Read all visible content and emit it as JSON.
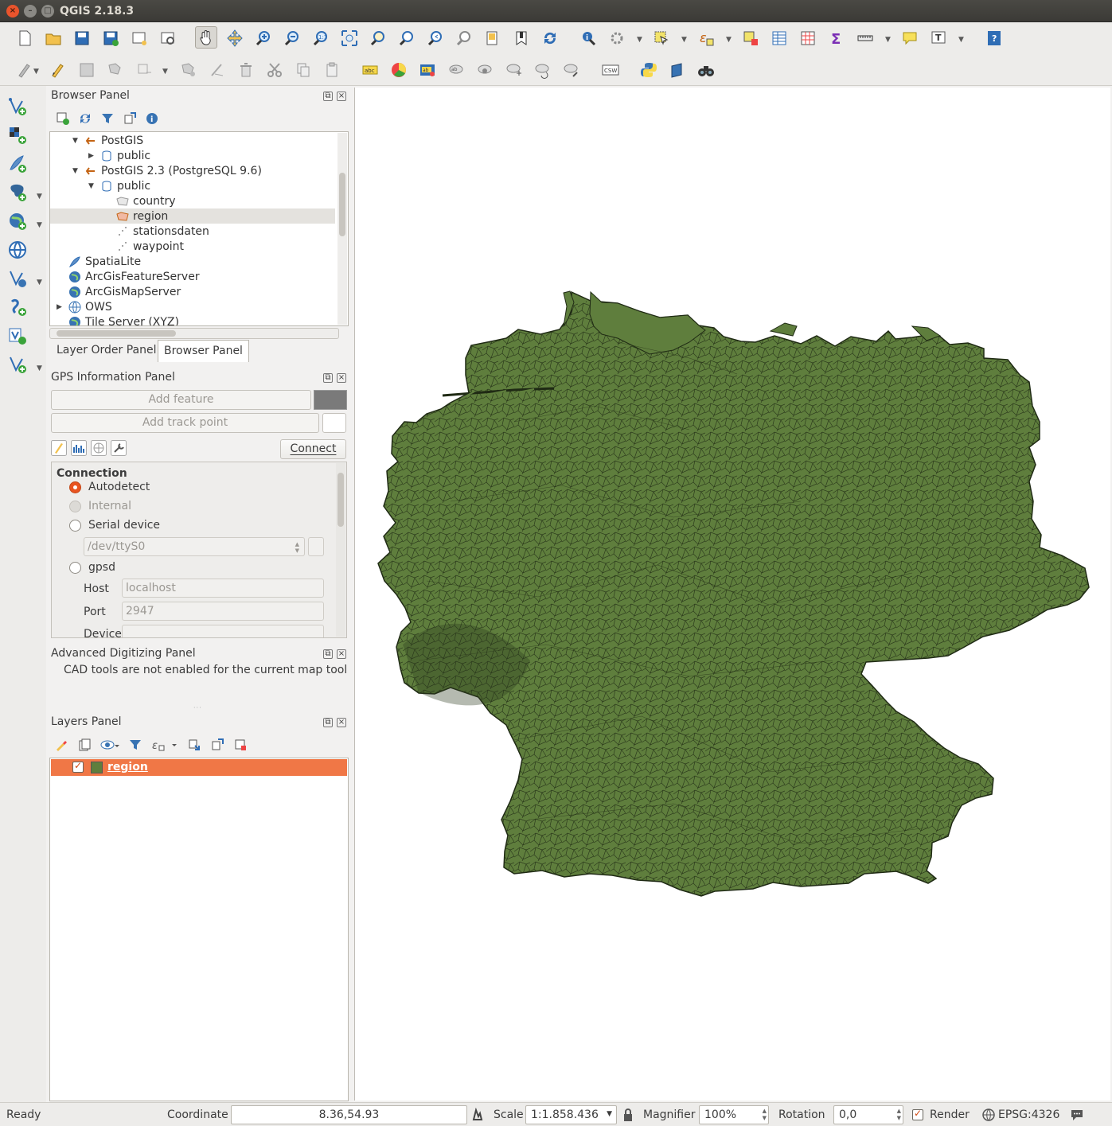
{
  "window": {
    "title": "QGIS 2.18.3"
  },
  "browser_panel": {
    "title": "Browser Panel",
    "tree": [
      {
        "label": "PostGIS",
        "level": 1,
        "arrow": "▼",
        "icon": "postgis-connection-icon"
      },
      {
        "label": "public",
        "level": 2,
        "arrow": "▶",
        "icon": "schema-icon"
      },
      {
        "label": "PostGIS 2.3 (PostgreSQL 9.6)",
        "level": 1,
        "arrow": "▼",
        "icon": "postgis-connection-icon"
      },
      {
        "label": "public",
        "level": 2,
        "arrow": "▼",
        "icon": "schema-icon"
      },
      {
        "label": "country",
        "level": 3,
        "arrow": "",
        "icon": "polygon-layer-icon"
      },
      {
        "label": "region",
        "level": 3,
        "arrow": "",
        "icon": "polygon-layer-icon",
        "selected": true
      },
      {
        "label": "stationsdaten",
        "level": 3,
        "arrow": "",
        "icon": "point-layer-icon"
      },
      {
        "label": "waypoint",
        "level": 3,
        "arrow": "",
        "icon": "point-layer-icon"
      },
      {
        "label": "SpatiaLite",
        "level": 0,
        "arrow": "",
        "icon": "spatialite-icon"
      },
      {
        "label": "ArcGisFeatureServer",
        "level": 0,
        "arrow": "",
        "icon": "arcgis-globe-icon"
      },
      {
        "label": "ArcGisMapServer",
        "level": 0,
        "arrow": "",
        "icon": "arcgis-globe-icon"
      },
      {
        "label": "OWS",
        "level": 0,
        "arrow": "▶",
        "icon": "ows-globe-icon"
      },
      {
        "label": "Tile Server (XYZ)",
        "level": 0,
        "arrow": "",
        "icon": "xyz-globe-icon"
      }
    ],
    "tabs": [
      "Layer Order Panel",
      "Browser Panel"
    ]
  },
  "gps_panel": {
    "title": "GPS Information Panel",
    "add_feature": "Add feature",
    "add_track_point": "Add track point",
    "connect": "Connect",
    "connection_heading": "Connection",
    "autodetect": "Autodetect",
    "internal": "Internal",
    "serial_device": "Serial device",
    "serial_port_value": "/dev/ttyS0",
    "gpsd": "gpsd",
    "host_label": "Host",
    "host_value": "localhost",
    "port_label": "Port",
    "port_value": "2947",
    "device_label": "Device"
  },
  "adv_digitizing": {
    "title": "Advanced Digitizing Panel",
    "message": "CAD tools are not enabled for the current map tool"
  },
  "layers_panel": {
    "title": "Layers Panel",
    "layers": [
      {
        "name": "region",
        "visible": true,
        "fill": "#5f7e3d"
      }
    ]
  },
  "map": {
    "fill_color": "#5f7e3d",
    "stroke_color": "#1f2a14"
  },
  "statusbar": {
    "ready": "Ready",
    "coordinate_label": "Coordinate",
    "coordinate_value": "8.36,54.93",
    "scale_label": "Scale",
    "scale_value": "1:1.858.436",
    "magnifier_label": "Magnifier",
    "magnifier_value": "100%",
    "rotation_label": "Rotation",
    "rotation_value": "0,0",
    "render_label": "Render",
    "crs_label": "EPSG:4326"
  }
}
